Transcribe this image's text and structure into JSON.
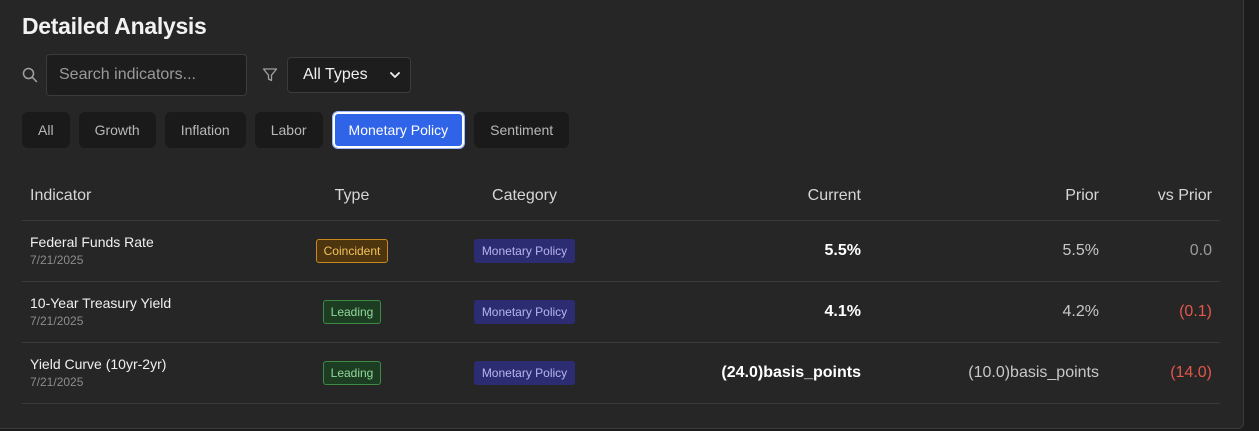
{
  "page": {
    "title": "Detailed Analysis"
  },
  "search": {
    "placeholder": "Search indicators..."
  },
  "type_filter": {
    "selected": "All Types"
  },
  "tabs": [
    {
      "label": "All",
      "active": false
    },
    {
      "label": "Growth",
      "active": false
    },
    {
      "label": "Inflation",
      "active": false
    },
    {
      "label": "Labor",
      "active": false
    },
    {
      "label": "Monetary Policy",
      "active": true
    },
    {
      "label": "Sentiment",
      "active": false
    }
  ],
  "table": {
    "headers": {
      "indicator": "Indicator",
      "type": "Type",
      "category": "Category",
      "current": "Current",
      "prior": "Prior",
      "vs_prior": "vs Prior"
    },
    "rows": [
      {
        "name": "Federal Funds Rate",
        "date": "7/21/2025",
        "type": "Coincident",
        "category": "Monetary Policy",
        "current": "5.5%",
        "prior": "5.5%",
        "vs_prior": "0.0"
      },
      {
        "name": "10-Year Treasury Yield",
        "date": "7/21/2025",
        "type": "Leading",
        "category": "Monetary Policy",
        "current": "4.1%",
        "prior": "4.2%",
        "vs_prior": "(0.1)"
      },
      {
        "name": "Yield Curve (10yr-2yr)",
        "date": "7/21/2025",
        "type": "Leading",
        "category": "Monetary Policy",
        "current": "(24.0)basis_points",
        "prior": "(10.0)basis_points",
        "vs_prior": "(14.0)"
      }
    ]
  },
  "colors": {
    "accent": "#2f63e8",
    "negative": "#e5564b",
    "coincident": "#f3c35a",
    "leading": "#8fd99b"
  }
}
